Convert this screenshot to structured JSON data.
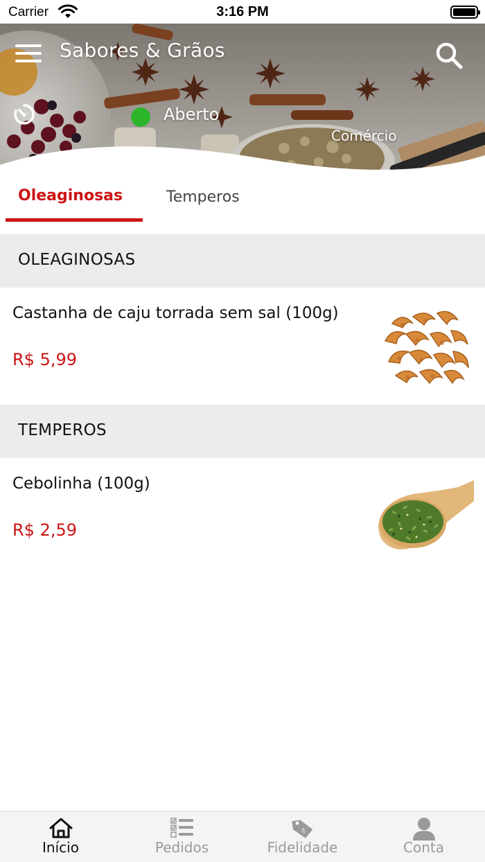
{
  "status_bar": {
    "carrier": "Carrier",
    "time": "3:16 PM"
  },
  "header": {
    "title": "Sabores & Grãos",
    "status": "Aberto",
    "category": "Comércio",
    "status_color": "#2db52a"
  },
  "tabs": [
    {
      "label": "Oleaginosas",
      "active": true
    },
    {
      "label": "Temperos",
      "active": false
    }
  ],
  "sections": [
    {
      "title": "OLEAGINOSAS",
      "products": [
        {
          "name": "Castanha de caju torrada sem sal (100g)",
          "price": "R$ 5,99",
          "image": "cashew-nuts"
        }
      ]
    },
    {
      "title": "TEMPEROS",
      "products": [
        {
          "name": "Cebolinha (100g)",
          "price": "R$ 2,59",
          "image": "dried-chives-on-spoon"
        }
      ]
    }
  ],
  "bottom_nav": [
    {
      "label": "Início",
      "icon": "home-icon",
      "active": true
    },
    {
      "label": "Pedidos",
      "icon": "orders-list-icon",
      "active": false
    },
    {
      "label": "Fidelidade",
      "icon": "tag-icon",
      "active": false
    },
    {
      "label": "Conta",
      "icon": "user-icon",
      "active": false
    }
  ],
  "colors": {
    "accent": "#cc1414",
    "inactive": "#9a9a9a"
  }
}
